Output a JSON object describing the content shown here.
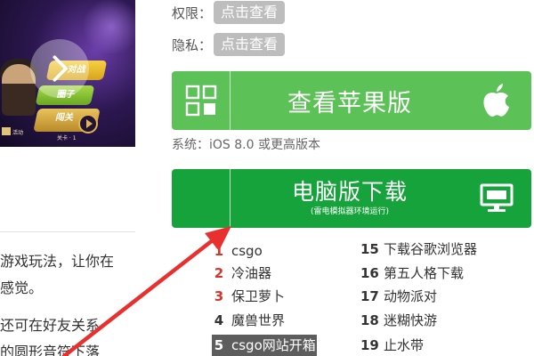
{
  "banner": {
    "pill_top": "对战",
    "pill_mid": "圈子",
    "pill_bottom": "闯关",
    "level_text": "关卡 · 1",
    "activity_text": "活动"
  },
  "article": {
    "lines": [
      "游戏玩法，让你在",
      "感觉。",
      "还可在好友关系",
      "的圆形音符下落"
    ]
  },
  "meta": {
    "permission_label": "权限：",
    "permission_link": "点击查看",
    "privacy_label": "隐私：",
    "privacy_link": "点击查看"
  },
  "apple_button": {
    "label": "查看苹果版",
    "left_icon": "grid-icon",
    "right_icon": "apple-icon"
  },
  "system": {
    "text": "系统：iOS 8.0 或更高版本"
  },
  "pc_button": {
    "label": "电脑版下载",
    "sublabel": "(雷电模拟器环境运行)",
    "right_icon": "monitor-icon"
  },
  "ranking": {
    "left": [
      {
        "rank": "1",
        "name": "csgo"
      },
      {
        "rank": "2",
        "name": "冷油器"
      },
      {
        "rank": "3",
        "name": "保卫萝卜"
      },
      {
        "rank": "4",
        "name": "魔兽世界"
      },
      {
        "rank": "5",
        "name": "csgo网站开箱"
      }
    ],
    "right": [
      {
        "rank": "15",
        "name": "下载谷歌浏览器"
      },
      {
        "rank": "16",
        "name": "第五人格下载"
      },
      {
        "rank": "17",
        "name": "动物派对"
      },
      {
        "rank": "18",
        "name": "迷糊快游"
      },
      {
        "rank": "19",
        "name": "止水带"
      }
    ]
  },
  "colors": {
    "apple_button": "#5cc156",
    "pc_button": "#17a33c",
    "top_rank": "#d9342b",
    "annotation_arrow": "#e8312f"
  }
}
